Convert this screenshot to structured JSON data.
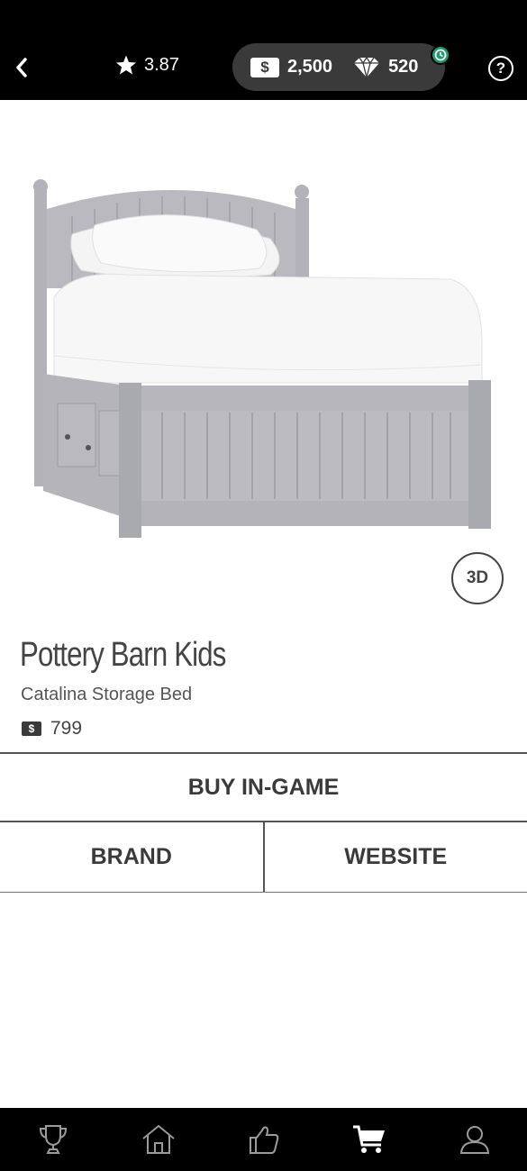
{
  "header": {
    "rating": "3.87",
    "cash_symbol": "$",
    "cash": "2,500",
    "gems": "520",
    "help_label": "?"
  },
  "product": {
    "badge_3d": "3D",
    "brand": "Pottery Barn Kids",
    "name": "Catalina Storage Bed",
    "price_symbol": "$",
    "price": "799"
  },
  "actions": {
    "buy": "BUY IN-GAME",
    "brand": "BRAND",
    "website": "WEBSITE"
  },
  "nav": {
    "items": [
      {
        "icon": "trophy-icon"
      },
      {
        "icon": "home-icon"
      },
      {
        "icon": "thumbs-up-icon"
      },
      {
        "icon": "cart-icon",
        "active": true
      },
      {
        "icon": "profile-icon"
      }
    ]
  },
  "colors": {
    "topbar": "#000000",
    "pill": "#3a3a3a",
    "timer_badge": "#1a9a6b",
    "bed": "#b7b7bd"
  }
}
